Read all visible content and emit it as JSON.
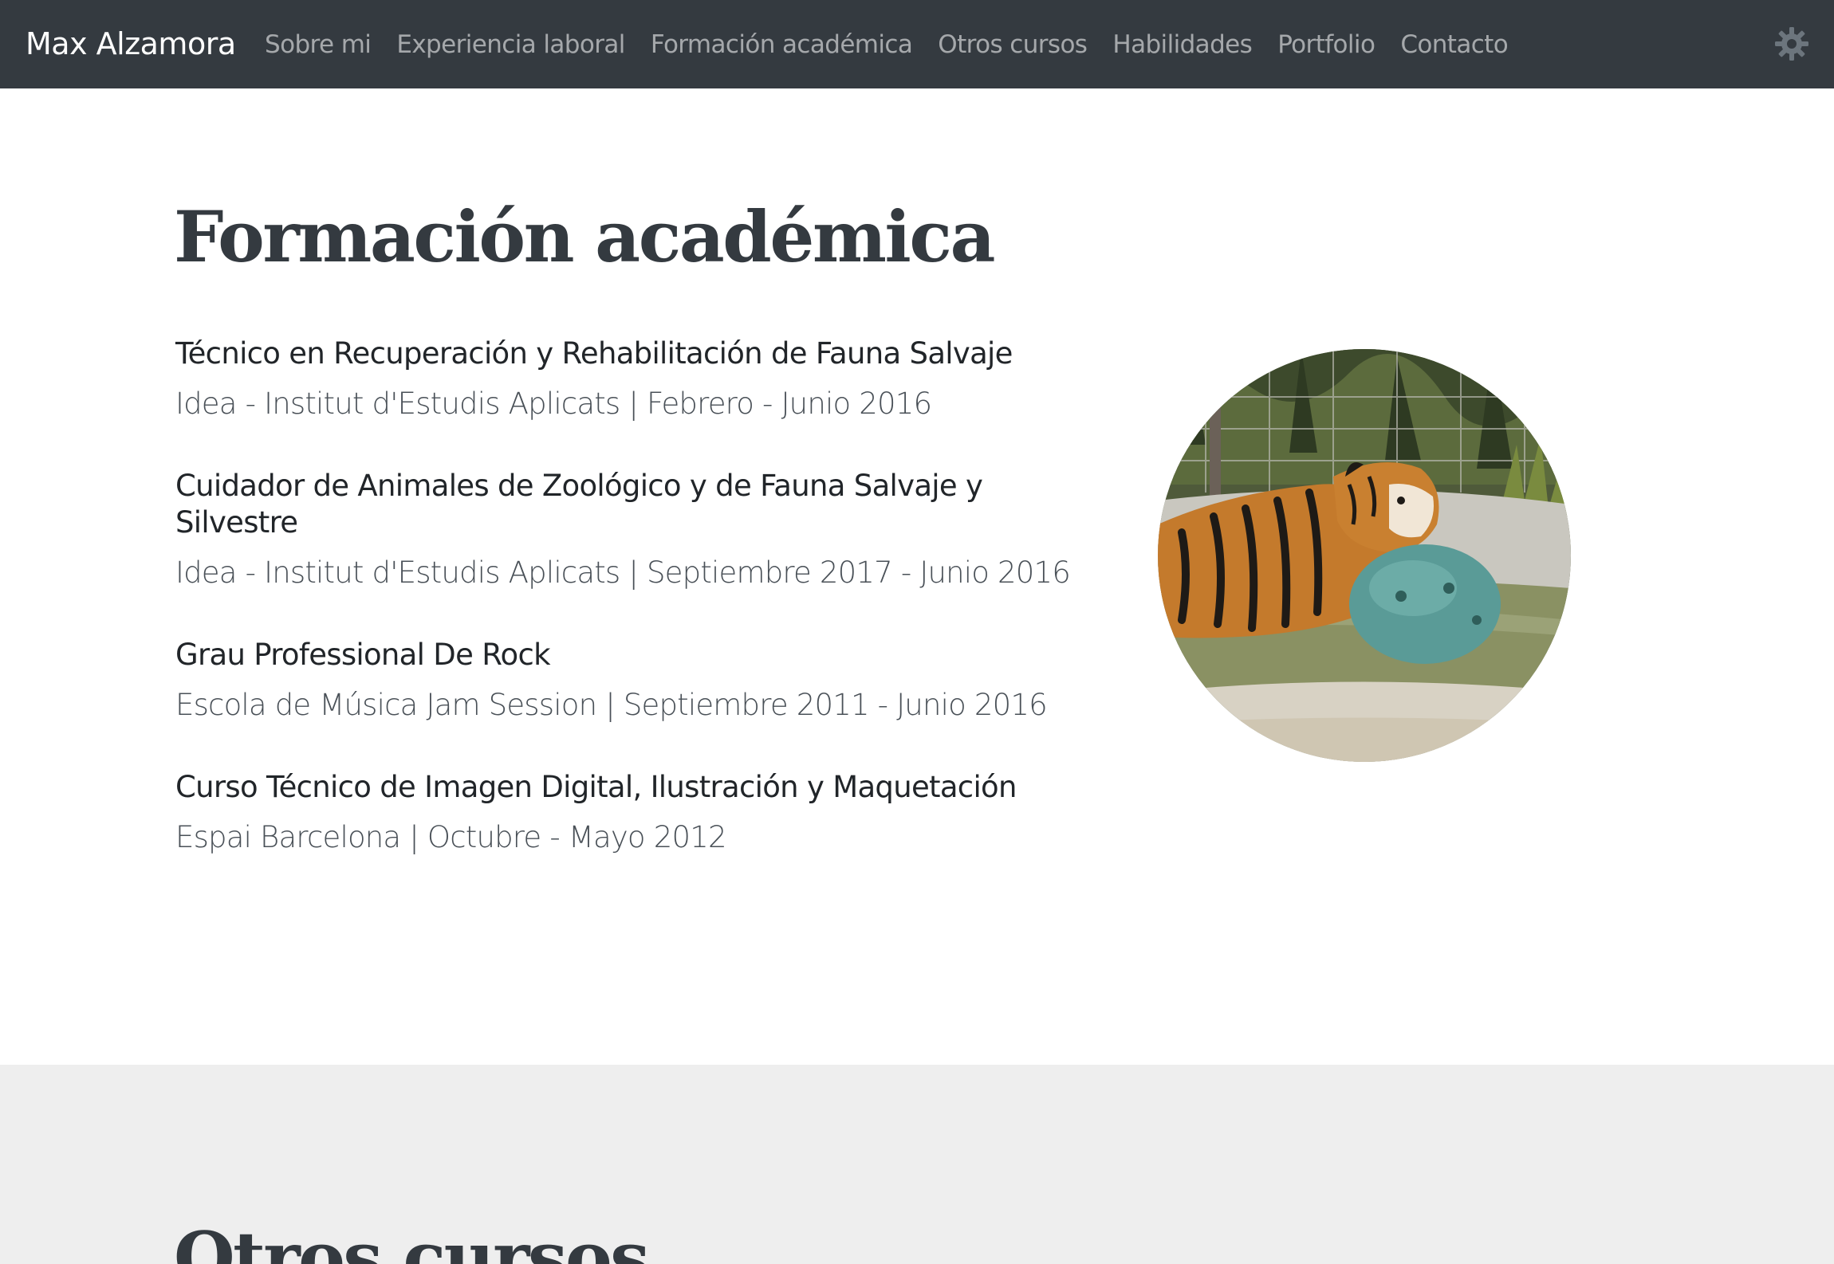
{
  "navbar": {
    "brand": "Max Alzamora",
    "links": [
      "Sobre mi",
      "Experiencia laboral",
      "Formación académica",
      "Otros cursos",
      "Habilidades",
      "Portfolio",
      "Contacto"
    ],
    "theme_icon": "gear-icon"
  },
  "education": {
    "title": "Formación académica",
    "items": [
      {
        "title": "Técnico en Recuperación y Rehabilitación de Fauna Salvaje",
        "meta": "Idea - Institut d'Estudis Aplicats | Febrero - Junio 2016"
      },
      {
        "title": "Cuidador de Animales de Zoológico y de Fauna Salvaje y Silvestre",
        "meta": "Idea - Institut d'Estudis Aplicats | Septiembre 2017 - Junio 2016"
      },
      {
        "title": "Grau Professional De Rock",
        "meta": "Escola de Música Jam Session | Septiembre 2011 - Junio 2016"
      },
      {
        "title": "Curso Técnico de Imagen Digital, Ilustración y Maquetación",
        "meta": "Espai Barcelona | Octubre - Mayo 2012"
      }
    ],
    "photo_icon": "tiger-photo"
  },
  "courses": {
    "title": "Otros cursos"
  }
}
